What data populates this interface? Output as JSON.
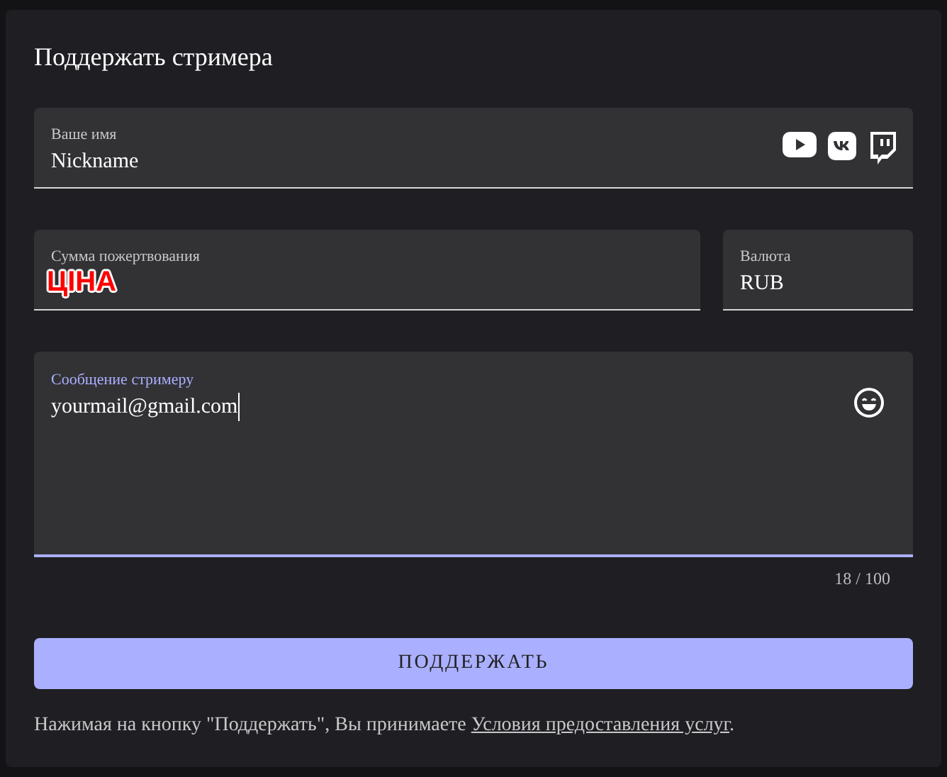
{
  "title": "Поддержать стримера",
  "name_field": {
    "label": "Ваше имя",
    "value": "Nickname",
    "focused": false
  },
  "amount_field": {
    "label": "Сумма пожертвования",
    "value": "ЦІНА",
    "focused": false
  },
  "currency_field": {
    "label": "Валюта",
    "value": "RUB",
    "focused": false
  },
  "message_field": {
    "label": "Сообщение стримеру",
    "value": "yourmail@gmail.com",
    "focused": true,
    "counter": "18 / 100"
  },
  "submit_button": {
    "label": "ПОДДЕРЖАТЬ"
  },
  "terms": {
    "text_before": "Нажимая на кнопку \"Поддержать\", Вы принимаете ",
    "link": "Условия предоставления услуг",
    "text_after": "."
  }
}
